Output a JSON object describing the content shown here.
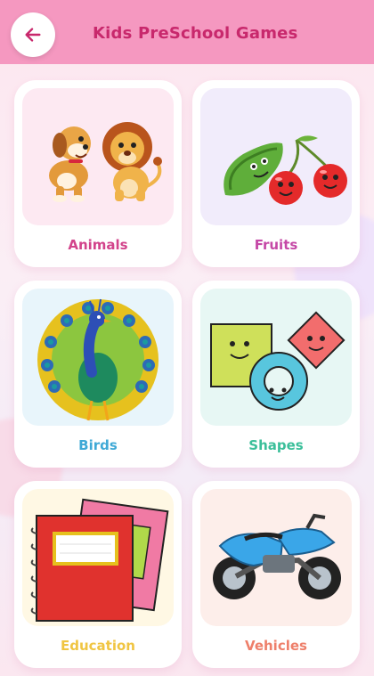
{
  "header": {
    "title": "Kids PreSchool Games",
    "back_icon": "arrow-left-icon"
  },
  "categories": [
    {
      "label": "Animals",
      "color": "#d2438b",
      "tile_bg": "#fde9f2",
      "icon": "animals-icon"
    },
    {
      "label": "Fruits",
      "color": "#c548a6",
      "tile_bg": "#f1ecfb",
      "icon": "fruits-icon"
    },
    {
      "label": "Birds",
      "color": "#3fa9d6",
      "tile_bg": "#e8f5fb",
      "icon": "peacock-icon"
    },
    {
      "label": "Shapes",
      "color": "#3bbf9a",
      "tile_bg": "#e7f7f4",
      "icon": "shapes-icon"
    },
    {
      "label": "Education",
      "color": "#f0c542",
      "tile_bg": "#fff8e4",
      "icon": "books-icon"
    },
    {
      "label": "Vehicles",
      "color": "#ee7f6a",
      "tile_bg": "#fdeeea",
      "icon": "motorbike-icon"
    }
  ]
}
